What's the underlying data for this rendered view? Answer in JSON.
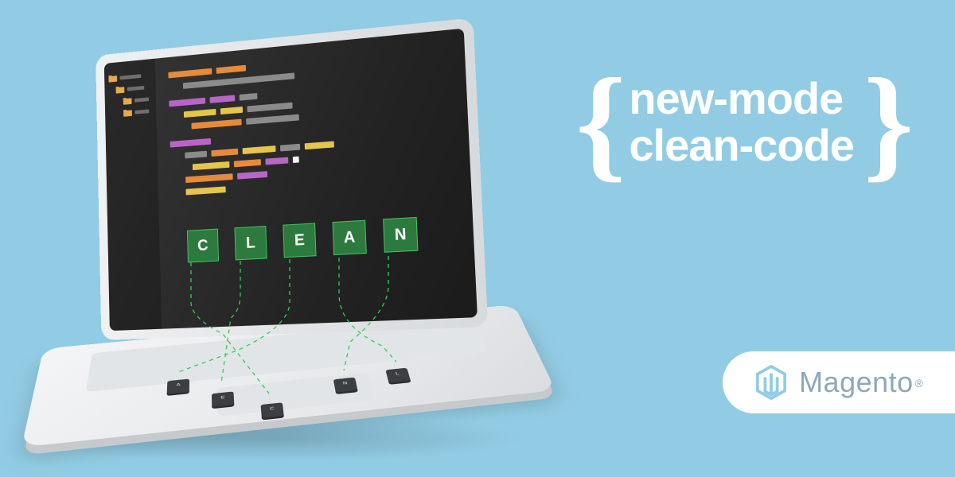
{
  "headline": {
    "line1": "new-mode",
    "line2": "clean-code"
  },
  "badge": {
    "name": "Magento"
  },
  "screen": {
    "letters": [
      "C",
      "L",
      "E",
      "A",
      "N"
    ]
  },
  "keyboard": {
    "keys": [
      "A",
      "E",
      "C",
      "N",
      "L"
    ]
  }
}
